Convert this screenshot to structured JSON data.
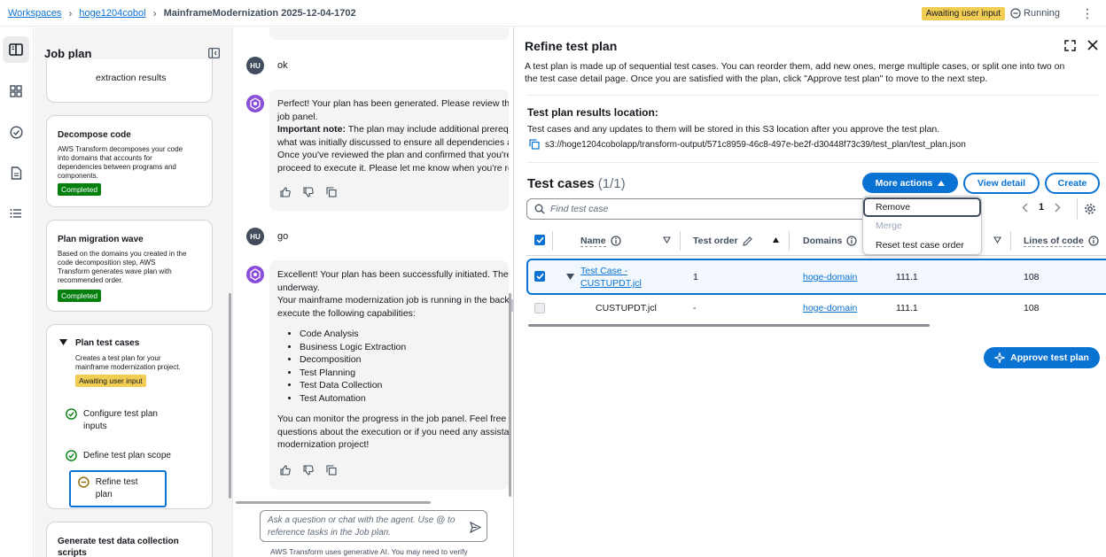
{
  "breadcrumb": {
    "items": [
      "Workspaces",
      "hoge1204cobol"
    ],
    "current": "MainframeModernization 2025-12-04-1702"
  },
  "status": {
    "badge": "Awaiting user input",
    "running": "Running"
  },
  "job_plan": {
    "title": "Job plan",
    "partial_card_text": "extraction results",
    "decompose": {
      "title": "Decompose code",
      "desc": [
        "AWS Transform decomposes your code",
        "into domains that accounts for",
        "dependencies between programs and",
        "components."
      ],
      "badge": "Completed"
    },
    "wave": {
      "title": "Plan migration wave",
      "desc": [
        "Based on the domains you created in the",
        "code decomposition step, AWS",
        "Transform generates wave plan with",
        "recommended order."
      ],
      "badge": "Completed"
    },
    "test_cases": {
      "title": "Plan test cases",
      "desc": [
        "Creates a test plan for your",
        "mainframe modernization project."
      ],
      "badge": "Awaiting user input",
      "steps": [
        {
          "label": "Configure test plan",
          "label2": "inputs"
        },
        {
          "label": "Define test plan scope"
        },
        {
          "label": "Refine test plan"
        }
      ]
    },
    "generate": {
      "title": "Generate test data collection",
      "title2": "scripts"
    }
  },
  "chat": {
    "user_initials": "HU",
    "msg_ok": "ok",
    "msg_go": "go",
    "bot1": {
      "line1": "Perfect! Your plan has been generated. Please review the",
      "line2": "job panel.",
      "note_label": "Important note:",
      "line3": " The plan may include additional prereq",
      "line4": "what was initially discussed to ensure all dependencies a",
      "line5": "Once you've reviewed the plan and confirmed that you're",
      "line6": "proceed to execute it. Please let me know when you're re"
    },
    "bot2": {
      "line1": "Excellent! Your plan has been successfully initiated. The",
      "line2": "underway.",
      "line3": "Your mainframe modernization job is running in the back",
      "line4": "execute the following capabilities:",
      "capabilities": [
        "Code Analysis",
        "Business Logic Extraction",
        "Decomposition",
        "Test Planning",
        "Test Data Collection",
        "Test Automation"
      ],
      "line5": "You can monitor the progress in the job panel. Feel free",
      "line6": "questions about the execution or if you need any assista",
      "line7": "modernization project!"
    },
    "input_placeholder_1": "Ask a question or chat with the agent. Use @ to",
    "input_placeholder_2": "reference tasks in the Job plan.",
    "disclaimer": "AWS Transform uses generative AI. You may need to verify"
  },
  "refine": {
    "title": "Refine test plan",
    "desc1": "A test plan is made up of sequential test cases. You can reorder them, add new ones, merge multiple cases, or split one into two on",
    "desc2": "the test case detail page. Once you are satisfied with the plan, click \"Approve test plan\" to move to the next step.",
    "location_title": "Test plan results location:",
    "location_desc": "Test cases and any updates to them will be stored in this S3 location after you approve the test plan.",
    "location_path": "s3://hoge1204cobolapp/transform-output/571c8959-46c8-497e-be2f-d30448f73c39/test_plan/test_plan.json",
    "test_cases_title": "Test cases",
    "test_cases_count": "(1/1)",
    "more_actions": "More actions",
    "view_detail": "View detail",
    "create": "Create",
    "search_placeholder": "Find test case",
    "page": "1",
    "dropdown": [
      "Remove",
      "Merge",
      "Reset test case order"
    ],
    "columns": {
      "name": "Name",
      "test_order": "Test order",
      "domains": "Domains",
      "lines_of_code": "Lines of code"
    },
    "rows": [
      {
        "name": "Test Case -",
        "name2": "CUSTUPDT.jcl",
        "order": "1",
        "domain": "hoge-domain",
        "col4": "111.1",
        "loc": "108"
      },
      {
        "name": "CUSTUPDT.jcl",
        "order": "-",
        "domain": "hoge-domain",
        "col4": "111.1",
        "loc": "108"
      }
    ],
    "approve": "Approve test plan"
  },
  "colors": {
    "accent": "#0972d3",
    "success": "#037f0c",
    "warning": "#f2cd54"
  }
}
